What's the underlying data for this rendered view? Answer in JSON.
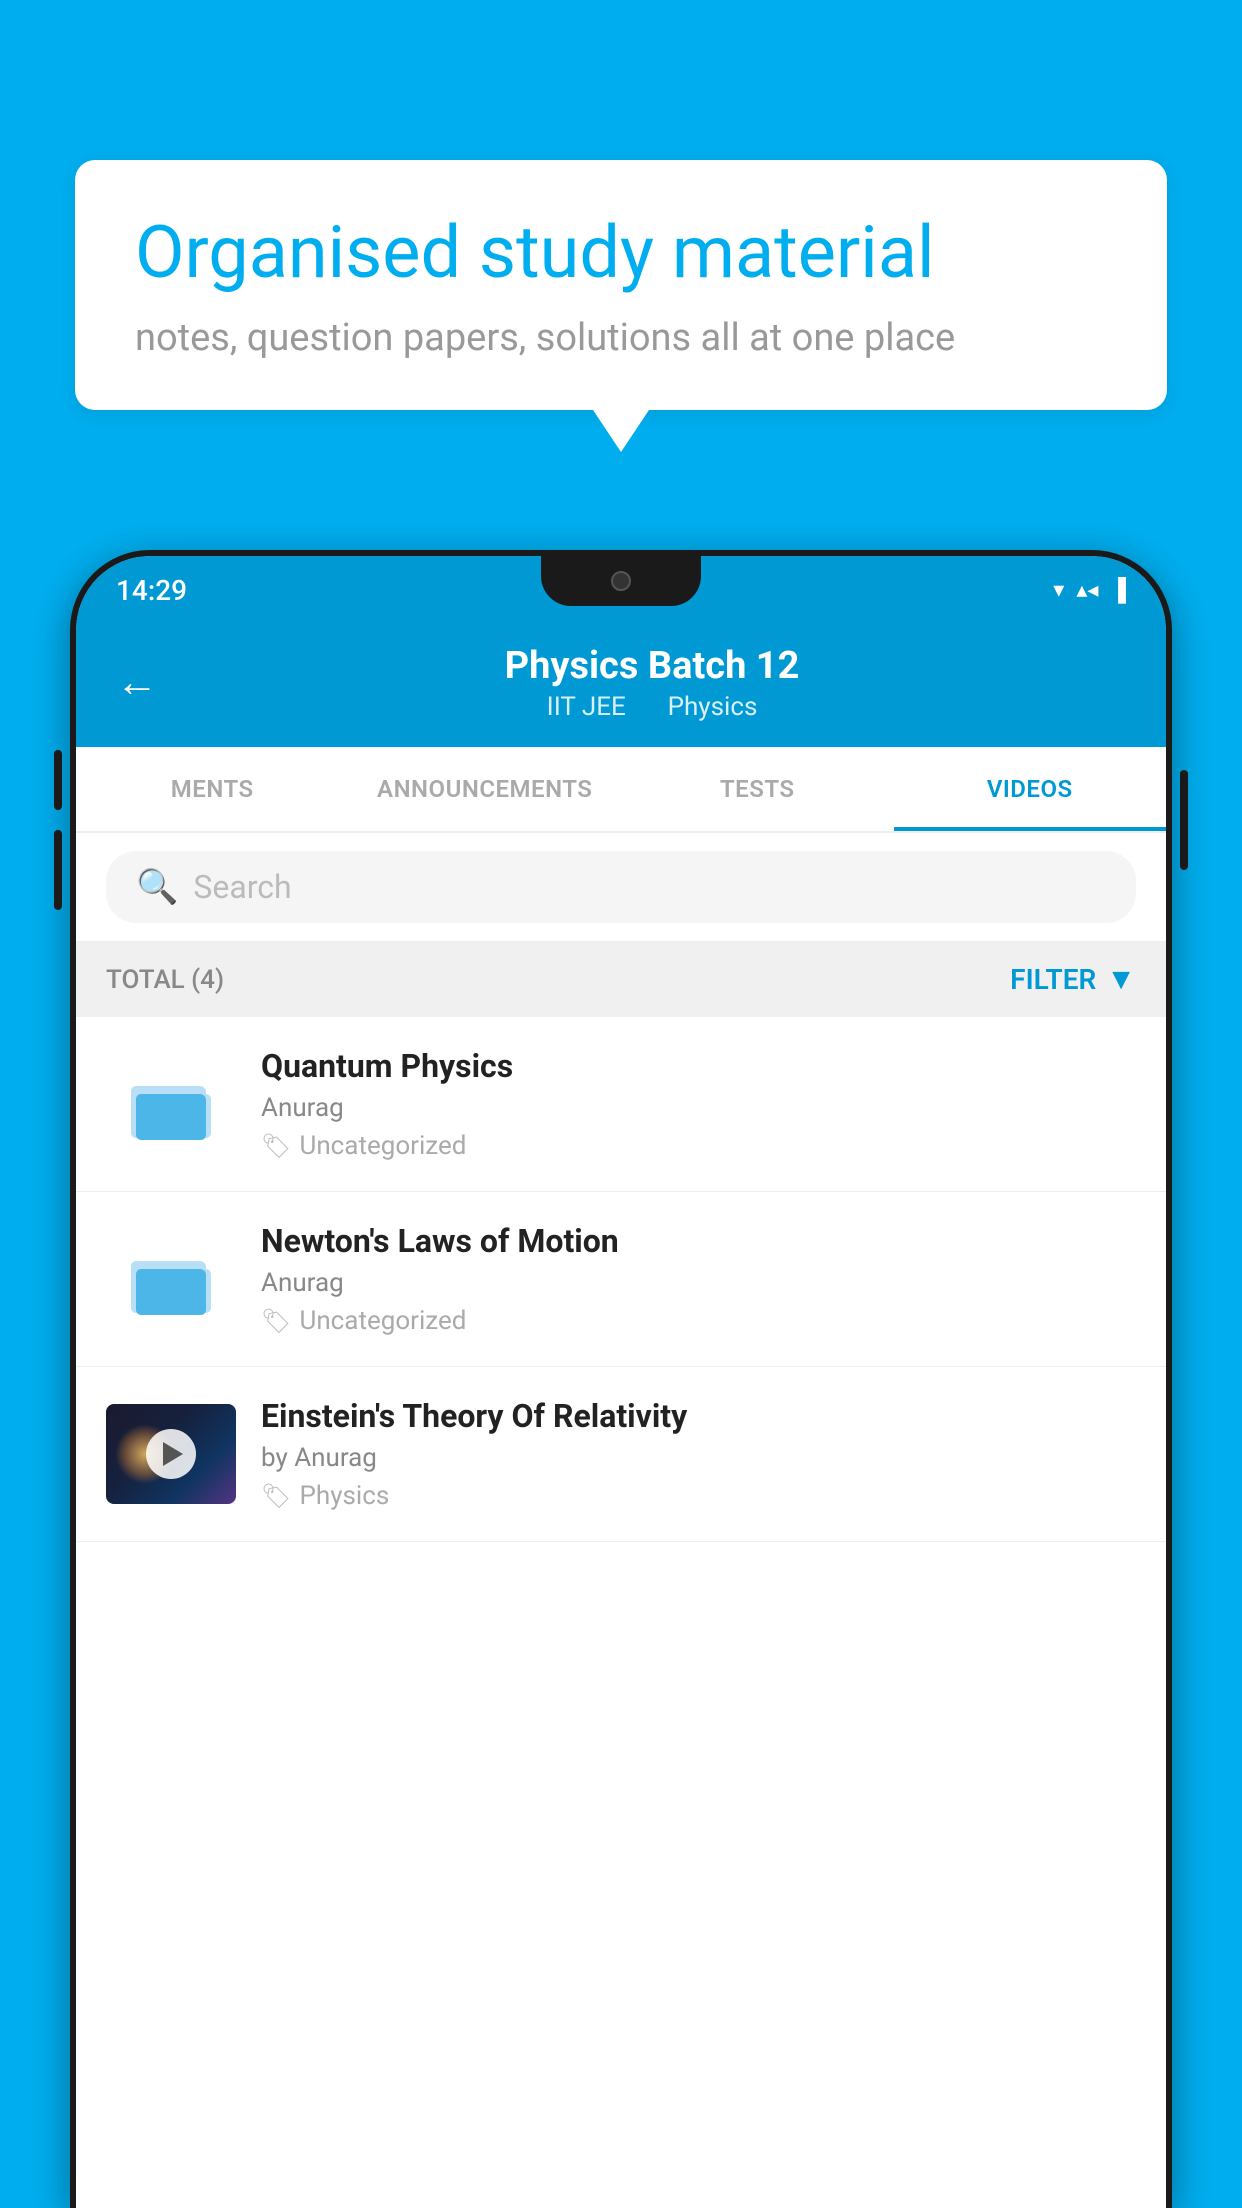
{
  "background_color": "#00AEEF",
  "speech_bubble": {
    "title": "Organised study material",
    "subtitle": "notes, question papers, solutions all at one place"
  },
  "status_bar": {
    "time": "14:29",
    "icons": "▼◀▐"
  },
  "app_header": {
    "back_label": "←",
    "title": "Physics Batch 12",
    "subtitle_part1": "IIT JEE",
    "subtitle_part2": "Physics"
  },
  "tabs": [
    {
      "label": "MENTS",
      "active": false
    },
    {
      "label": "ANNOUNCEMENTS",
      "active": false
    },
    {
      "label": "TESTS",
      "active": false
    },
    {
      "label": "VIDEOS",
      "active": true
    }
  ],
  "search": {
    "placeholder": "Search"
  },
  "filter_bar": {
    "total_label": "TOTAL (4)",
    "filter_label": "FILTER"
  },
  "video_items": [
    {
      "id": 1,
      "title": "Quantum Physics",
      "author": "Anurag",
      "tag": "Uncategorized",
      "type": "folder",
      "has_thumb": false
    },
    {
      "id": 2,
      "title": "Newton's Laws of Motion",
      "author": "Anurag",
      "tag": "Uncategorized",
      "type": "folder",
      "has_thumb": false
    },
    {
      "id": 3,
      "title": "Einstein's Theory Of Relativity",
      "author": "by Anurag",
      "tag": "Physics",
      "type": "video",
      "has_thumb": true
    }
  ]
}
